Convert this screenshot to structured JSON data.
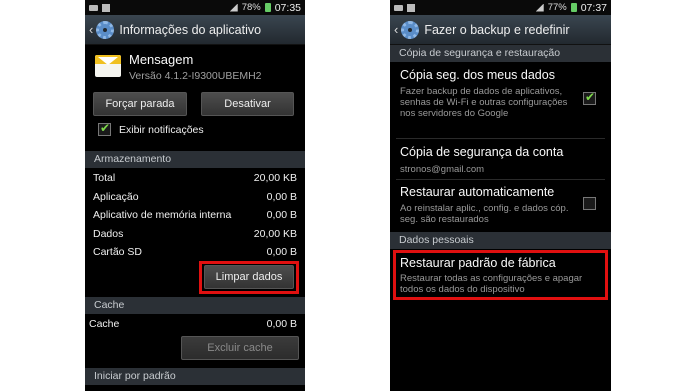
{
  "left_screen": {
    "status": {
      "battery": "78%",
      "time": "07:35"
    },
    "title": "Informações do aplicativo",
    "app_name": "Mensagem",
    "app_version": "Versão 4.1.2-I9300UBEMH2",
    "force_stop_label": "Forçar parada",
    "disable_label": "Desativar",
    "show_notifications_label": "Exibir notificações",
    "show_notifications_checked": true,
    "storage_header": "Armazenamento",
    "storage_rows": [
      {
        "label": "Total",
        "value": "20,00 KB"
      },
      {
        "label": "Aplicação",
        "value": "0,00 B"
      },
      {
        "label": "Aplicativo de memória interna",
        "value": "0,00 B"
      },
      {
        "label": "Dados",
        "value": "20,00 KB"
      },
      {
        "label": "Cartão SD",
        "value": "0,00 B"
      }
    ],
    "clear_data_label": "Limpar dados",
    "cache_header": "Cache",
    "cache_label": "Cache",
    "cache_value": "0,00 B",
    "clear_cache_label": "Excluir cache",
    "launch_default_header": "Iniciar por padrão"
  },
  "right_screen": {
    "status": {
      "battery": "77%",
      "time": "07:37"
    },
    "title": "Fazer o backup e redefinir",
    "backup_header": "Cópia de segurança e restauração",
    "backup_my_data_title": "Cópia seg. dos meus dados",
    "backup_my_data_desc": "Fazer backup de dados de aplicativos, senhas de Wi-Fi e outras configurações nos servidores do Google",
    "backup_my_data_checked": true,
    "backup_account_title": "Cópia de segurança da conta",
    "backup_account_value": "stronos@gmail.com",
    "auto_restore_title": "Restaurar automaticamente",
    "auto_restore_desc": "Ao reinstalar aplic., config. e dados cóp. seg. são restaurados",
    "auto_restore_checked": false,
    "personal_header": "Dados pessoais",
    "factory_reset_title": "Restaurar padrão de fábrica",
    "factory_reset_desc": "Restaurar todas as configurações e apagar todos os dados do dispositivo"
  },
  "colors": {
    "highlight": "#e01010",
    "check": "#7dd84a"
  },
  "icons": [
    "back-chevron-icon",
    "settings-gear-icon",
    "message-app-icon",
    "usb-icon",
    "signal-icon",
    "battery-icon"
  ]
}
